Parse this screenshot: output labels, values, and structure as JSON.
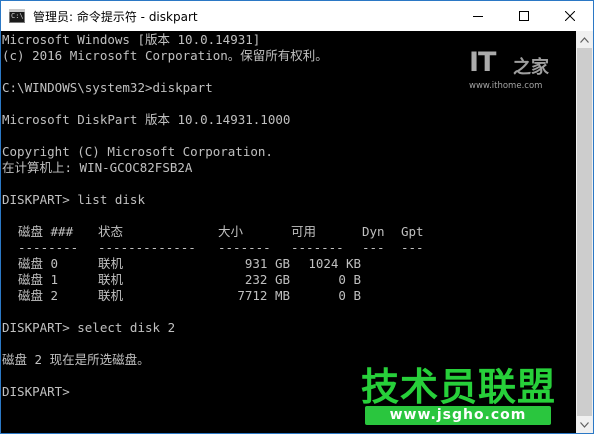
{
  "window": {
    "title": "管理员: 命令提示符 - diskpart",
    "icon_label": "C:\\",
    "controls": {
      "minimize": "minimize-icon",
      "maximize": "maximize-icon",
      "close": "close-icon"
    },
    "accent_color": "#2b78c5"
  },
  "console": {
    "lines": [
      "Microsoft Windows [版本 10.0.14931]",
      "(c) 2016 Microsoft Corporation。保留所有权利。",
      "",
      "C:\\WINDOWS\\system32>diskpart",
      "",
      "Microsoft DiskPart 版本 10.0.14931.1000",
      "",
      "Copyright (C) Microsoft Corporation.",
      "在计算机上: WIN-GCOC82FSB2A",
      "",
      "DISKPART> list disk",
      ""
    ],
    "disk_table": {
      "headers": [
        "磁盘 ###",
        "状态",
        "大小",
        "可用",
        "Dyn",
        "Gpt"
      ],
      "separators": [
        "--------",
        "-------------",
        "-------",
        "-------",
        "---",
        "---"
      ],
      "rows": [
        [
          "磁盘 0",
          "联机",
          "931 GB",
          "1024 KB",
          "",
          ""
        ],
        [
          "磁盘 1",
          "联机",
          "232 GB",
          "0 B",
          "",
          ""
        ],
        [
          "磁盘 2",
          "联机",
          "7712 MB",
          "0 B",
          "",
          ""
        ]
      ]
    },
    "after_lines": [
      "",
      "DISKPART> select disk 2",
      "",
      "磁盘 2 现在是所选磁盘。",
      "",
      "DISKPART>"
    ],
    "text_color": "#c0c0c0",
    "background_color": "#000000"
  },
  "watermarks": {
    "ithome": {
      "logo": "IT",
      "logo_cn": "之家",
      "url": "www.ithome.com"
    },
    "jsgho": {
      "title": "技术员联盟",
      "url": "www.jsgho.com",
      "color": "#27d03a"
    }
  }
}
